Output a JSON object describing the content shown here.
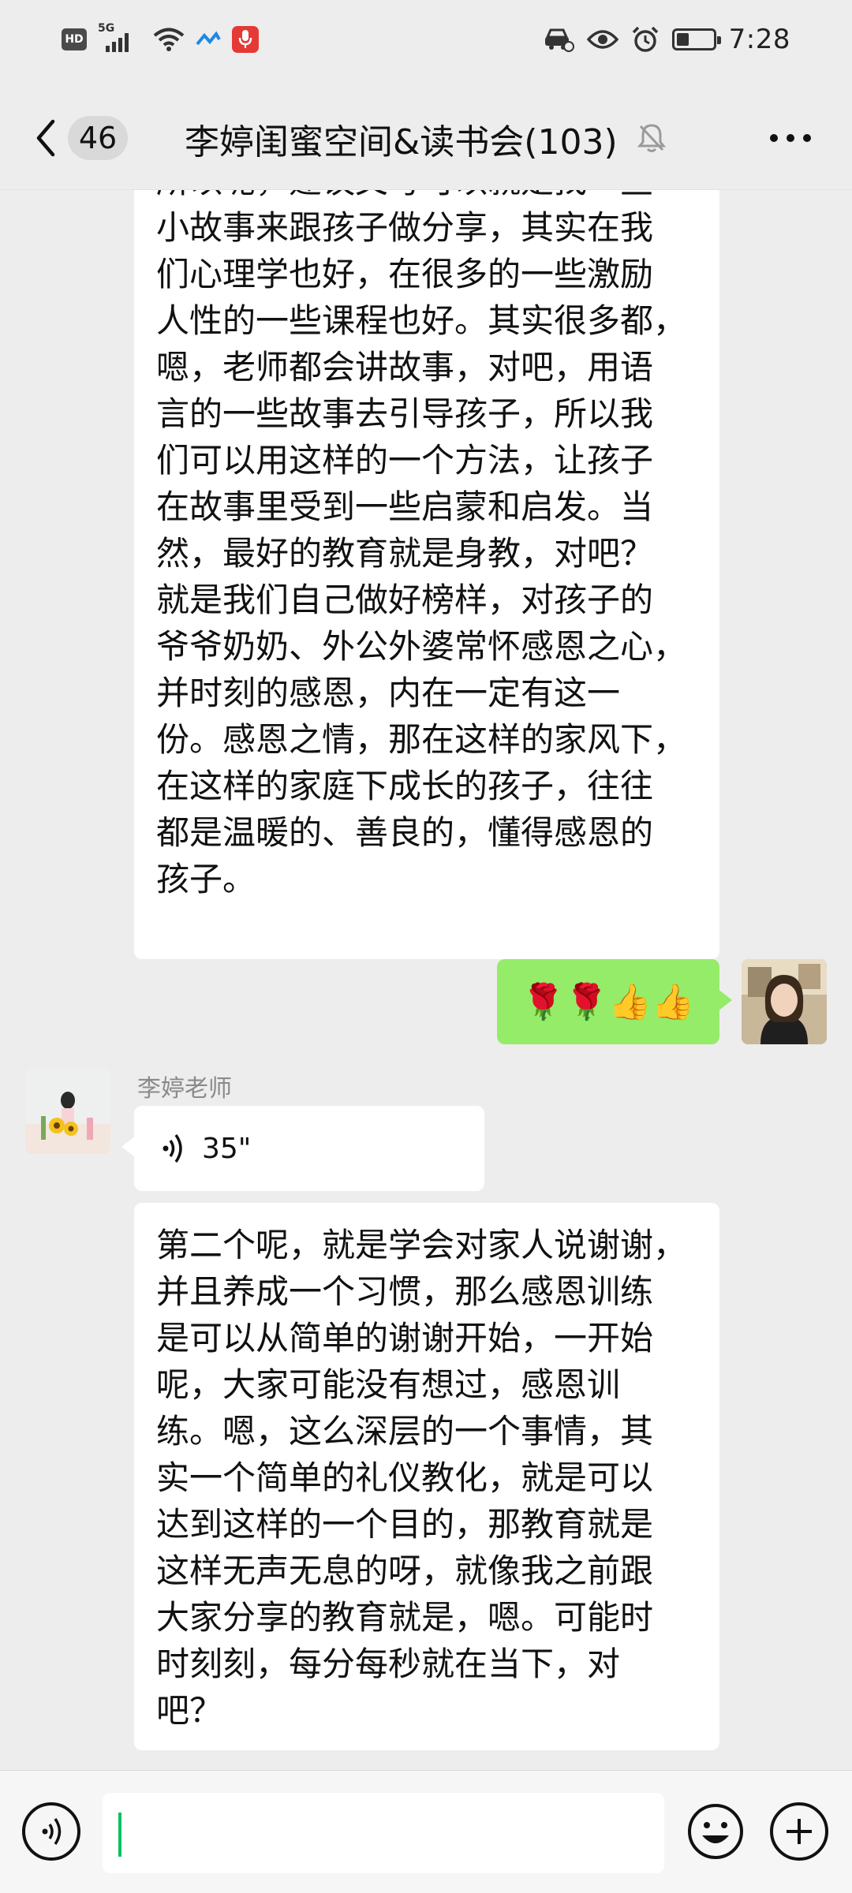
{
  "status_bar": {
    "hd_label": "HD",
    "network_label": "5G",
    "time": "7:28",
    "battery_level": 0.35,
    "icons": [
      "hd-icon",
      "signal-icon",
      "wifi-icon",
      "data-transfer-icon",
      "recording-mic-icon",
      "car-mode-icon",
      "eye-icon",
      "alarm-icon",
      "battery-icon"
    ]
  },
  "nav": {
    "unread_count": "46",
    "title": "李婷闺蜜空间&读书会(103)",
    "icons": [
      "back-icon",
      "mute-bell-icon",
      "more-icon"
    ]
  },
  "messages": [
    {
      "type": "text",
      "side": "left",
      "lines": [
        "所以呢，建议父母可以就是找一些",
        "小故事来跟孩子做分享，其实在我",
        "们心理学也好，在很多的一些激励",
        "人性的一些课程也好。其实很多都，",
        "嗯，老师都会讲故事，对吧，用语",
        "言的一些故事去引导孩子，所以我",
        "们可以用这样的一个方法，让孩子",
        "在故事里受到一些启蒙和启发。当",
        "然，最好的教育就是身教，对吧？",
        "就是我们自己做好榜样，对孩子的",
        "爷爷奶奶、外公外婆常怀感恩之心，",
        "并时刻的感恩，内在一定有这一",
        "份。感恩之情，那在这样的家风下，",
        "在这样的家庭下成长的孩子，往往",
        "都是温暖的、善良的，懂得感恩的",
        "孩子。"
      ]
    },
    {
      "type": "emoji",
      "side": "right",
      "text": "🌹🌹👍👍"
    },
    {
      "type": "voice",
      "side": "left",
      "sender": "李婷老师",
      "duration": "35\""
    },
    {
      "type": "text",
      "side": "left",
      "lines": [
        "第二个呢，就是学会对家人说谢谢，",
        "并且养成一个习惯，那么感恩训练",
        "是可以从简单的谢谢开始，一开始",
        "呢，大家可能没有想过，感恩训",
        "练。嗯，这么深层的一个事情，其",
        "实一个简单的礼仪教化，就是可以",
        "达到这样的一个目的，那教育就是",
        "这样无声无息的呀，就像我之前跟",
        "大家分享的教育就是，嗯。可能时",
        "时刻刻，每分每秒就在当下，对",
        "吧？"
      ]
    }
  ],
  "input_bar": {
    "value": "",
    "icons": [
      "voice-input-icon",
      "emoji-icon",
      "plus-icon"
    ]
  },
  "colors": {
    "background": "#ededed",
    "incoming_bubble": "#ffffff",
    "outgoing_bubble": "#95ec69",
    "caret": "#07c160",
    "recording_badge": "#e53935"
  }
}
